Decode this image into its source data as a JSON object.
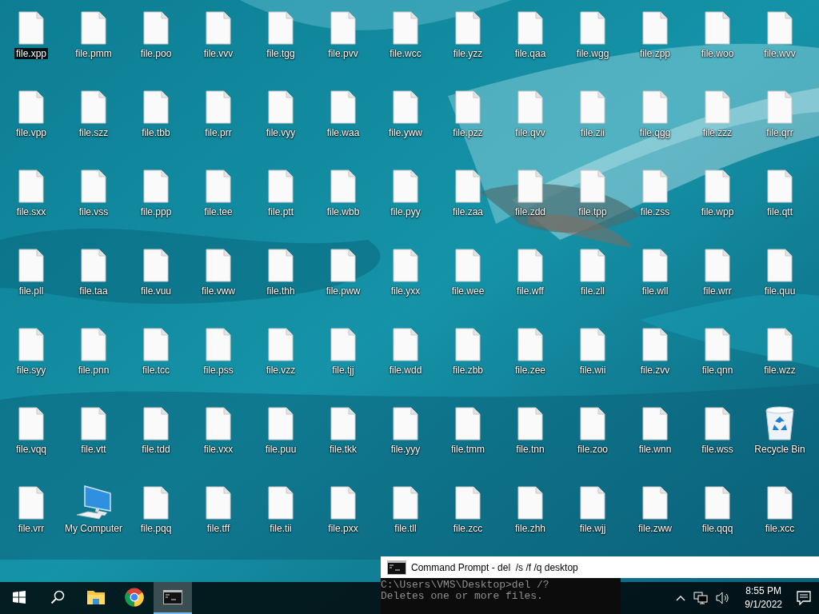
{
  "desktop": {
    "icons": [
      {
        "label": "file.xpp",
        "kind": "file",
        "selected": true
      },
      {
        "label": "file.pmm",
        "kind": "file",
        "selected": false
      },
      {
        "label": "file.poo",
        "kind": "file",
        "selected": false
      },
      {
        "label": "file.vvv",
        "kind": "file",
        "selected": false
      },
      {
        "label": "file.tgg",
        "kind": "file",
        "selected": false
      },
      {
        "label": "file.pvv",
        "kind": "file",
        "selected": false
      },
      {
        "label": "file.wcc",
        "kind": "file",
        "selected": false
      },
      {
        "label": "file.yzz",
        "kind": "file",
        "selected": false
      },
      {
        "label": "file.qaa",
        "kind": "file",
        "selected": false
      },
      {
        "label": "file.wgg",
        "kind": "file",
        "selected": false
      },
      {
        "label": "file.zpp",
        "kind": "file",
        "selected": false
      },
      {
        "label": "file.woo",
        "kind": "file",
        "selected": false
      },
      {
        "label": "file.wvv",
        "kind": "file",
        "selected": false
      },
      {
        "label": "file.vpp",
        "kind": "file",
        "selected": false
      },
      {
        "label": "file.szz",
        "kind": "file",
        "selected": false
      },
      {
        "label": "file.tbb",
        "kind": "file",
        "selected": false
      },
      {
        "label": "file.prr",
        "kind": "file",
        "selected": false
      },
      {
        "label": "file.vyy",
        "kind": "file",
        "selected": false
      },
      {
        "label": "file.waa",
        "kind": "file",
        "selected": false
      },
      {
        "label": "file.yww",
        "kind": "file",
        "selected": false
      },
      {
        "label": "file.pzz",
        "kind": "file",
        "selected": false
      },
      {
        "label": "file.qvv",
        "kind": "file",
        "selected": false
      },
      {
        "label": "file.zii",
        "kind": "file",
        "selected": false
      },
      {
        "label": "file.qgg",
        "kind": "file",
        "selected": false
      },
      {
        "label": "file.zzz",
        "kind": "file",
        "selected": false
      },
      {
        "label": "file.qrr",
        "kind": "file",
        "selected": false
      },
      {
        "label": "file.sxx",
        "kind": "file",
        "selected": false
      },
      {
        "label": "file.vss",
        "kind": "file",
        "selected": false
      },
      {
        "label": "file.ppp",
        "kind": "file",
        "selected": false
      },
      {
        "label": "file.tee",
        "kind": "file",
        "selected": false
      },
      {
        "label": "file.ptt",
        "kind": "file",
        "selected": false
      },
      {
        "label": "file.wbb",
        "kind": "file",
        "selected": false
      },
      {
        "label": "file.pyy",
        "kind": "file",
        "selected": false
      },
      {
        "label": "file.zaa",
        "kind": "file",
        "selected": false
      },
      {
        "label": "file.zdd",
        "kind": "file",
        "selected": false
      },
      {
        "label": "file.tpp",
        "kind": "file",
        "selected": false
      },
      {
        "label": "file.zss",
        "kind": "file",
        "selected": false
      },
      {
        "label": "file.wpp",
        "kind": "file",
        "selected": false
      },
      {
        "label": "file.qtt",
        "kind": "file",
        "selected": false
      },
      {
        "label": "file.pll",
        "kind": "file",
        "selected": false
      },
      {
        "label": "file.taa",
        "kind": "file",
        "selected": false
      },
      {
        "label": "file.vuu",
        "kind": "file",
        "selected": false
      },
      {
        "label": "file.vww",
        "kind": "file",
        "selected": false
      },
      {
        "label": "file.thh",
        "kind": "file",
        "selected": false
      },
      {
        "label": "file.pww",
        "kind": "file",
        "selected": false
      },
      {
        "label": "file.yxx",
        "kind": "file",
        "selected": false
      },
      {
        "label": "file.wee",
        "kind": "file",
        "selected": false
      },
      {
        "label": "file.wff",
        "kind": "file",
        "selected": false
      },
      {
        "label": "file.zll",
        "kind": "file",
        "selected": false
      },
      {
        "label": "file.wll",
        "kind": "file",
        "selected": false
      },
      {
        "label": "file.wrr",
        "kind": "file",
        "selected": false
      },
      {
        "label": "file.quu",
        "kind": "file",
        "selected": false
      },
      {
        "label": "file.syy",
        "kind": "file",
        "selected": false
      },
      {
        "label": "file.pnn",
        "kind": "file",
        "selected": false
      },
      {
        "label": "file.tcc",
        "kind": "file",
        "selected": false
      },
      {
        "label": "file.pss",
        "kind": "file",
        "selected": false
      },
      {
        "label": "file.vzz",
        "kind": "file",
        "selected": false
      },
      {
        "label": "file.tjj",
        "kind": "file",
        "selected": false
      },
      {
        "label": "file.wdd",
        "kind": "file",
        "selected": false
      },
      {
        "label": "file.zbb",
        "kind": "file",
        "selected": false
      },
      {
        "label": "file.zee",
        "kind": "file",
        "selected": false
      },
      {
        "label": "file.wii",
        "kind": "file",
        "selected": false
      },
      {
        "label": "file.zvv",
        "kind": "file",
        "selected": false
      },
      {
        "label": "file.qnn",
        "kind": "file",
        "selected": false
      },
      {
        "label": "file.wzz",
        "kind": "file",
        "selected": false
      },
      {
        "label": "file.vqq",
        "kind": "file",
        "selected": false
      },
      {
        "label": "file.vtt",
        "kind": "file",
        "selected": false
      },
      {
        "label": "file.tdd",
        "kind": "file",
        "selected": false
      },
      {
        "label": "file.vxx",
        "kind": "file",
        "selected": false
      },
      {
        "label": "file.puu",
        "kind": "file",
        "selected": false
      },
      {
        "label": "file.tkk",
        "kind": "file",
        "selected": false
      },
      {
        "label": "file.yyy",
        "kind": "file",
        "selected": false
      },
      {
        "label": "file.tmm",
        "kind": "file",
        "selected": false
      },
      {
        "label": "file.tnn",
        "kind": "file",
        "selected": false
      },
      {
        "label": "file.zoo",
        "kind": "file",
        "selected": false
      },
      {
        "label": "file.wnn",
        "kind": "file",
        "selected": false
      },
      {
        "label": "file.wss",
        "kind": "file",
        "selected": false
      },
      {
        "label": "Recycle Bin",
        "kind": "recycle",
        "selected": false
      },
      {
        "label": "file.vrr",
        "kind": "file",
        "selected": false
      },
      {
        "label": "My Computer",
        "kind": "computer",
        "selected": false
      },
      {
        "label": "file.pqq",
        "kind": "file",
        "selected": false
      },
      {
        "label": "file.tff",
        "kind": "file",
        "selected": false
      },
      {
        "label": "file.tii",
        "kind": "file",
        "selected": false
      },
      {
        "label": "file.pxx",
        "kind": "file",
        "selected": false
      },
      {
        "label": "file.tll",
        "kind": "file",
        "selected": false
      },
      {
        "label": "file.zcc",
        "kind": "file",
        "selected": false
      },
      {
        "label": "file.zhh",
        "kind": "file",
        "selected": false
      },
      {
        "label": "file.wjj",
        "kind": "file",
        "selected": false
      },
      {
        "label": "file.zww",
        "kind": "file",
        "selected": false
      },
      {
        "label": "file.qqq",
        "kind": "file",
        "selected": false
      },
      {
        "label": "file.xcc",
        "kind": "file",
        "selected": false
      }
    ]
  },
  "console_window": {
    "title": "Command Prompt - del  /s /f /q desktop",
    "lines": [
      "C:\\Users\\VMS\\Desktop>del /?",
      "Deletes one or more files."
    ]
  },
  "taskbar": {
    "apps": [
      {
        "kind": "start",
        "selected": false
      },
      {
        "kind": "search",
        "selected": false
      },
      {
        "kind": "explorer",
        "selected": false
      },
      {
        "kind": "browser",
        "selected": false
      },
      {
        "kind": "console",
        "selected": true
      }
    ],
    "clock": {
      "time": "8:55 PM",
      "date": "9/1/2022"
    }
  }
}
